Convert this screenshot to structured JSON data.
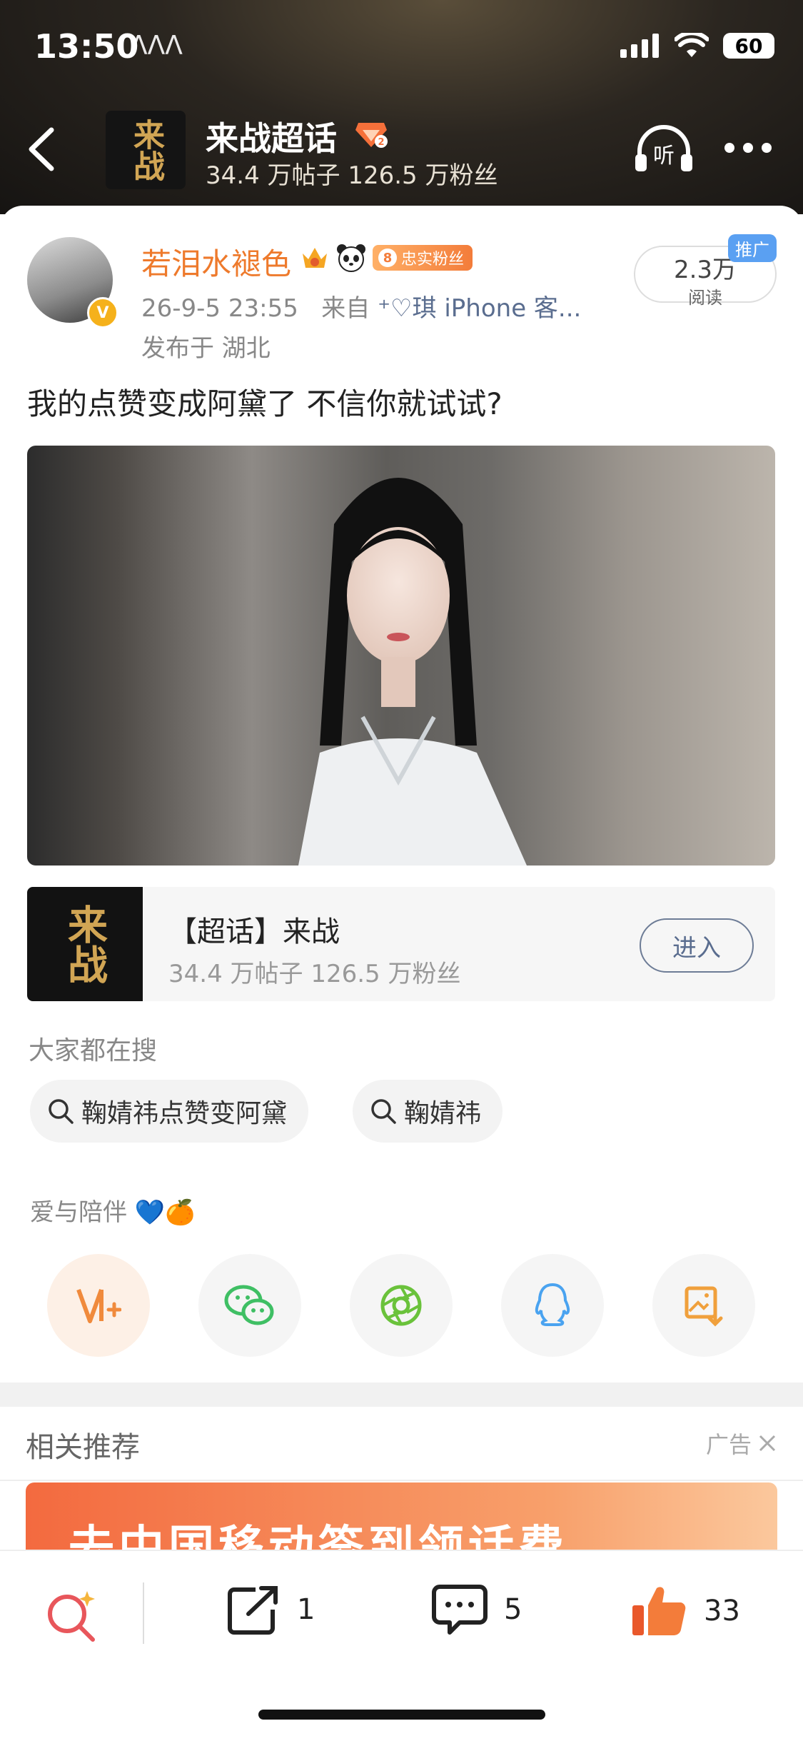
{
  "status_bar": {
    "time": "13:50",
    "extra": "ᐱᐱᐱ",
    "battery": "60"
  },
  "header": {
    "thumb_text": "来战",
    "topic_title": "来战超话",
    "topic_stats": "34.4 万帖子 126.5 万粉丝",
    "listen_label": "听"
  },
  "post": {
    "username": "若泪水褪色",
    "fan_badge_level": "8",
    "fan_badge_label": "忠实粉丝",
    "meta_time": "26-9-5 23:55",
    "meta_from": "来自",
    "meta_client": "⁺♡琪 iPhone 客...",
    "location": "发布于 湖北",
    "reads_count": "2.3万",
    "reads_label": "阅读",
    "promo_tag": "推广",
    "text": "我的点赞变成阿黛了 不信你就试试?"
  },
  "super_topic_card": {
    "thumb_text": "来战",
    "title": "【超话】来战",
    "stats": "34.4 万帖子 126.5 万粉丝",
    "enter_label": "进入"
  },
  "hot_search": {
    "title": "大家都在搜",
    "chips": [
      {
        "label": "鞠婧祎点赞变阿黛"
      },
      {
        "label": "鞠婧祎"
      }
    ]
  },
  "love_line": {
    "text": "爱与陪伴",
    "emoji": "💙🍊"
  },
  "share_icons": [
    "weibo-vplus-icon",
    "wechat-icon",
    "moments-icon",
    "qq-icon",
    "save-image-icon"
  ],
  "recommend": {
    "title": "相关推荐",
    "ad_label": "广告",
    "ad_text": "去中国移动签到领话费"
  },
  "bottom_bar": {
    "repost_count": "1",
    "comment_count": "5",
    "like_count": "33"
  },
  "colors": {
    "username": "#ee7a2c",
    "accent_orange": "#f37c3a",
    "link_blue": "#5a6d8f"
  }
}
